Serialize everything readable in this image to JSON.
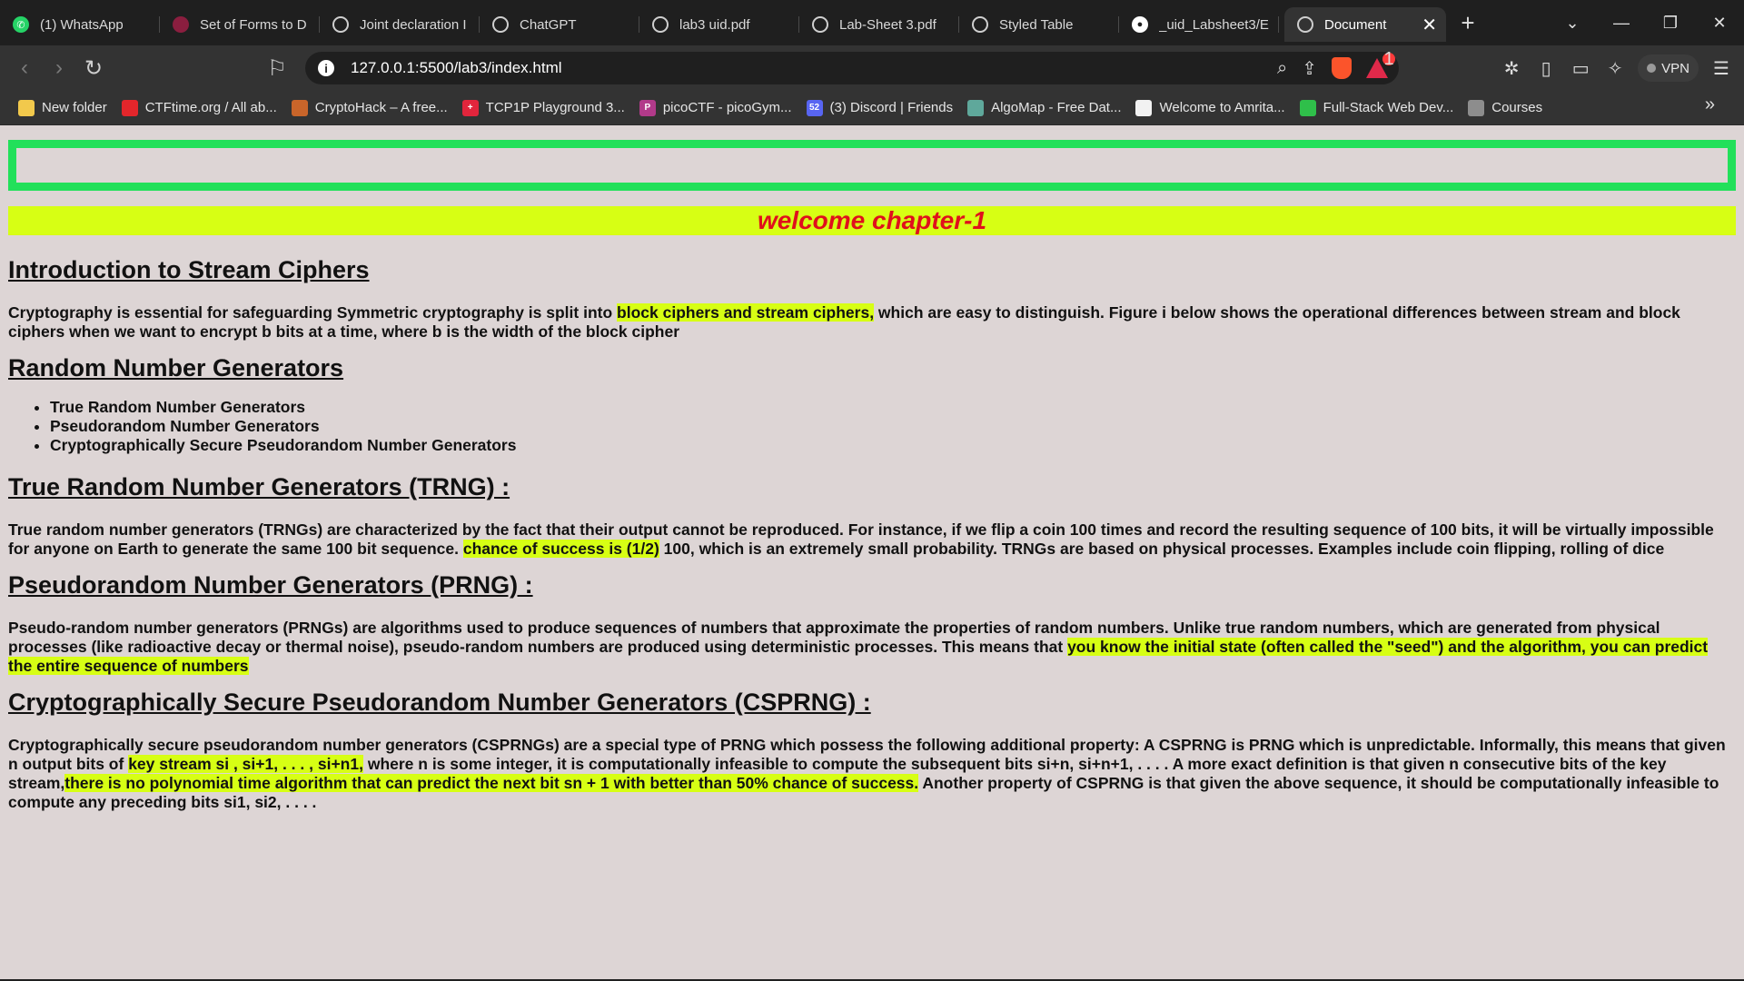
{
  "browser": {
    "tabs": [
      {
        "title": "(1) WhatsApp",
        "icon": "whatsapp-icon",
        "favclass": "fav-wa",
        "glyph": "✆"
      },
      {
        "title": "Set of Forms to D",
        "icon": "forms-icon",
        "favclass": "fav-forms",
        "glyph": ""
      },
      {
        "title": "Joint declaration I",
        "icon": "globe-icon",
        "favclass": "fav-globe",
        "glyph": ""
      },
      {
        "title": "ChatGPT",
        "icon": "chatgpt-icon",
        "favclass": "fav-gpt",
        "glyph": "✣"
      },
      {
        "title": "lab3 uid.pdf",
        "icon": "globe-icon",
        "favclass": "fav-globe",
        "glyph": ""
      },
      {
        "title": "Lab-Sheet 3.pdf",
        "icon": "globe-icon",
        "favclass": "fav-globe",
        "glyph": ""
      },
      {
        "title": "Styled Table",
        "icon": "globe-icon",
        "favclass": "fav-globe",
        "glyph": ""
      },
      {
        "title": "_uid_Labsheet3/E",
        "icon": "github-icon",
        "favclass": "fav-gh",
        "glyph": "●"
      }
    ],
    "active_tab": {
      "title": "Document",
      "icon": "globe-icon",
      "close": "✕"
    },
    "new_tab_glyph": "+",
    "url": "127.0.0.1:5500/lab3/index.html",
    "vpn_label": "VPN",
    "alert_count": "1",
    "bookmarks": [
      {
        "label": "New folder",
        "icon": "folder-icon",
        "color": "#f2c94c",
        "glyph": ""
      },
      {
        "label": "CTFtime.org / All ab...",
        "icon": "ctftime-icon",
        "color": "#e3262b",
        "glyph": ""
      },
      {
        "label": "CryptoHack – A free...",
        "icon": "cryptohack-icon",
        "color": "#c9652a",
        "glyph": ""
      },
      {
        "label": "TCP1P Playground 3...",
        "icon": "tcp1p-icon",
        "color": "#e2253c",
        "glyph": "+"
      },
      {
        "label": "picoCTF - picoGym...",
        "icon": "picoctf-icon",
        "color": "#b23a8a",
        "glyph": "P"
      },
      {
        "label": "(3) Discord | Friends",
        "icon": "discord-icon",
        "color": "#5865f2",
        "glyph": "52"
      },
      {
        "label": "AlgoMap - Free Dat...",
        "icon": "algomap-icon",
        "color": "#5fa89b",
        "glyph": ""
      },
      {
        "label": "Welcome to Amrita...",
        "icon": "amrita-icon",
        "color": "#f2f2f2",
        "glyph": ""
      },
      {
        "label": "Full-Stack Web Dev...",
        "icon": "fullstack-icon",
        "color": "#2fbf4a",
        "glyph": ""
      },
      {
        "label": "Courses",
        "icon": "courses-icon",
        "color": "#8d8d8d",
        "glyph": ""
      }
    ]
  },
  "page": {
    "banner": "welcome chapter-1",
    "sections": {
      "intro": {
        "heading": "Introduction to Stream Ciphers",
        "p_before": "Cryptography is essential for safeguarding Symmetric cryptography is split into ",
        "p_highlight": "block ciphers and stream ciphers,",
        "p_after": " which are easy to distinguish. Figure i below shows the operational differences between stream and block ciphers when we want to encrypt b bits at a time, where b is the width of the block cipher"
      },
      "rng": {
        "heading": "Random Number Generators",
        "items": [
          "True Random Number Generators",
          "Pseudorandom Number Generators",
          "Cryptographically Secure Pseudorandom Number Generators"
        ]
      },
      "trng": {
        "heading": "True Random Number Generators (TRNG) :",
        "p_before": "True random number generators (TRNGs) are characterized by the fact that their output cannot be reproduced. For instance, if we flip a coin 100 times and record the resulting sequence of 100 bits, it will be virtually impossible for anyone on Earth to generate the same 100 bit sequence. ",
        "p_highlight": "chance of success is (1/2)",
        "p_after": " 100, which is an extremely small probability. TRNGs are based on physical processes. Examples include coin flipping, rolling of dice"
      },
      "prng": {
        "heading": "Pseudorandom Number Generators (PRNG) :",
        "p_before": "Pseudo-random number generators (PRNGs) are algorithms used to produce sequences of numbers that approximate the properties of random numbers. Unlike true random numbers, which are generated from physical processes (like radioactive decay or thermal noise), pseudo-random numbers are produced using deterministic processes. This means that ",
        "p_highlight": "you know the initial state (often called the \"seed\") and the algorithm, you can predict the entire sequence of numbers",
        "p_after": ""
      },
      "csprng": {
        "heading": "Cryptographically Secure Pseudorandom Number Generators (CSPRNG) :",
        "p_part1": "Cryptographically secure pseudorandom number generators (CSPRNGs) are a special type of PRNG which possess the following additional property: A CSPRNG is PRNG which is unpredictable. Informally, this means that given n output bits of ",
        "p_highlight1": "key stream si , si+1, . . . , si+n1,",
        "p_part2": " where n is some integer, it is computationally infeasible to compute the subsequent bits si+n, si+n+1, . . . . A more exact definition is that given n consecutive bits of the key stream,",
        "p_highlight2": "there is no polynomial time algorithm that can predict the next bit sn + 1 with better than 50% chance of success.",
        "p_part3": " Another property of CSPRNG is that given the above sequence, it should be computationally infeasible to compute any preceding bits si1, si2, . . . ."
      }
    }
  },
  "colors": {
    "page_bg": "#ddd5d5",
    "green_border": "#22e05a",
    "banner_bg": "#d7ff14",
    "banner_text": "#e0101c",
    "highlight": "#d7ff14"
  }
}
